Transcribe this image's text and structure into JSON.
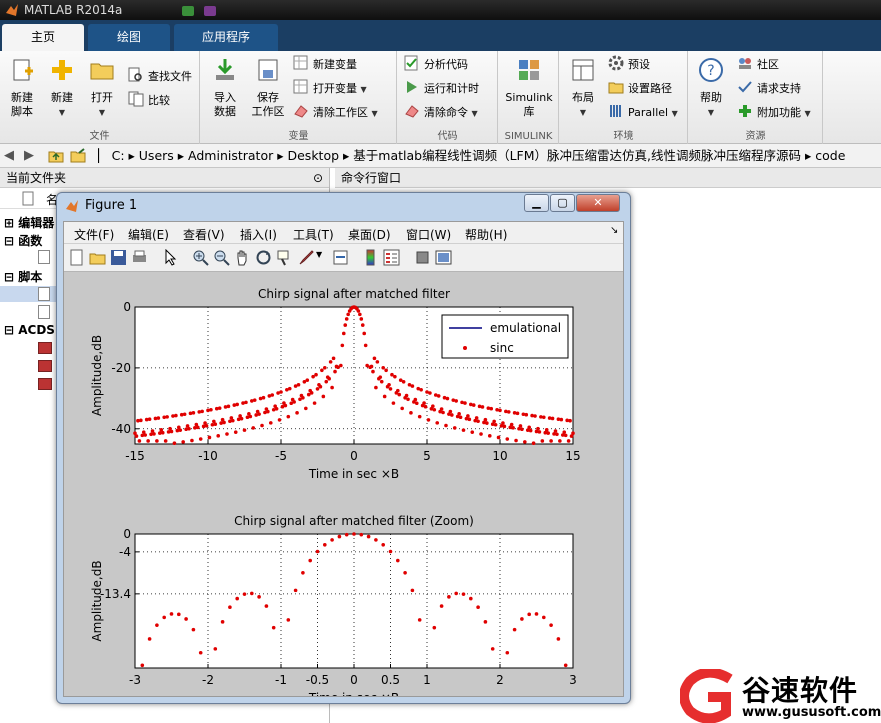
{
  "app": {
    "title": "MATLAB R2014a"
  },
  "tabs": [
    "主页",
    "绘图",
    "应用程序"
  ],
  "ribbon": {
    "file": {
      "caption": "文件",
      "new_script": "新建\n脚本",
      "new": "新建",
      "open": "打开",
      "find_files": "查找文件",
      "compare": "比较"
    },
    "variable": {
      "caption": "变量",
      "import": "导入\n数据",
      "save_ws": "保存\n工作区",
      "new_var": "新建变量",
      "open_var": "打开变量",
      "clear_ws": "清除工作区"
    },
    "code": {
      "caption": "代码",
      "analyze": "分析代码",
      "run_time": "运行和计时",
      "clear_cmd": "清除命令"
    },
    "simulink": {
      "caption": "SIMULINK",
      "lib": "Simulink\n库"
    },
    "env": {
      "caption": "环境",
      "layout": "布局",
      "prefs": "预设",
      "set_path": "设置路径",
      "parallel": "Parallel"
    },
    "resources": {
      "caption": "资源",
      "help": "帮助",
      "community": "社区",
      "support": "请求支持",
      "addons": "附加功能"
    }
  },
  "address": {
    "segments": [
      "C:",
      "Users",
      "Administrator",
      "Desktop",
      "基于matlab编程线性调频（LFM）脉冲压缩雷达仿真,线性调频脉冲压缩程序源码",
      "code"
    ]
  },
  "left_panel": {
    "title": "当前文件夹",
    "col_name": "名",
    "tree": [
      "编辑器",
      "函数",
      "脚本",
      "ACDS"
    ]
  },
  "right_panel": {
    "title": "命令行窗口"
  },
  "figure": {
    "title": "Figure 1",
    "menu": [
      "文件(F)",
      "编辑(E)",
      "查看(V)",
      "插入(I)",
      "工具(T)",
      "桌面(D)",
      "窗口(W)",
      "帮助(H)"
    ]
  },
  "chart_data": [
    {
      "type": "scatter",
      "title": "Chirp signal after matched filter",
      "xlabel": "Time in sec ×B",
      "ylabel": "Amplitude,dB",
      "xlim": [
        -15,
        15
      ],
      "ylim": [
        -45,
        0
      ],
      "xticks": [
        "-15",
        "-10",
        "-5",
        "0",
        "5",
        "10",
        "15"
      ],
      "yticks": [
        "0",
        "-20",
        "-40"
      ],
      "grid": true,
      "legend": "top-right",
      "series": [
        {
          "name": "emulational",
          "style": "line",
          "color": "#000080"
        },
        {
          "name": "sinc",
          "style": "dots",
          "color": "#e00000"
        }
      ]
    },
    {
      "type": "scatter",
      "title": "Chirp signal after matched filter (Zoom)",
      "xlabel": "Time in sec ×B",
      "ylabel": "Amplitude,dB",
      "xlim": [
        -3,
        3
      ],
      "ylim": [
        -30,
        0
      ],
      "xticks": [
        "-3",
        "-2",
        "-1",
        "-0.5",
        "0",
        "0.5",
        "1",
        "2",
        "3"
      ],
      "yticks": [
        "0",
        "-4",
        "-13.4"
      ],
      "grid": true,
      "series": [
        {
          "name": "sinc",
          "style": "dots",
          "color": "#e00000"
        }
      ]
    }
  ],
  "watermark": {
    "brand": "谷速软件",
    "url": "www.gususoft.com"
  },
  "colors": {
    "accent": "#1e5387",
    "dark": "#1b3e63",
    "plot_red": "#e00000",
    "plot_blue": "#000080"
  }
}
